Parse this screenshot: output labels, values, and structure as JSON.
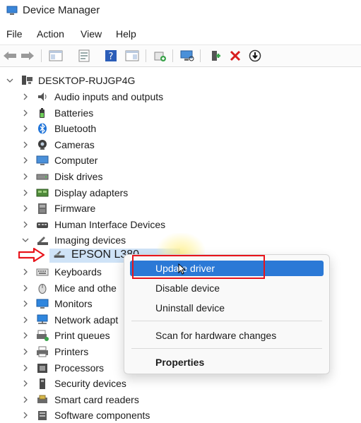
{
  "window": {
    "title": "Device Manager"
  },
  "menubar": {
    "items": [
      "File",
      "Action",
      "View",
      "Help"
    ]
  },
  "toolbar": {
    "icons": [
      "back-arrow-icon",
      "forward-arrow-icon",
      "show-hide-console-tree-icon",
      "properties-icon",
      "help-icon",
      "action-pane-icon",
      "update-driver-icon",
      "scan-hardware-icon",
      "enable-device-icon",
      "uninstall-device-icon",
      "disable-device-icon"
    ]
  },
  "tree": {
    "root": "DESKTOP-RUJGP4G",
    "categories": [
      {
        "label": "Audio inputs and outputs",
        "icon": "speaker-icon"
      },
      {
        "label": "Batteries",
        "icon": "battery-icon"
      },
      {
        "label": "Bluetooth",
        "icon": "bluetooth-icon"
      },
      {
        "label": "Cameras",
        "icon": "camera-icon"
      },
      {
        "label": "Computer",
        "icon": "computer-icon"
      },
      {
        "label": "Disk drives",
        "icon": "disk-drive-icon"
      },
      {
        "label": "Display adapters",
        "icon": "display-adapter-icon"
      },
      {
        "label": "Firmware",
        "icon": "firmware-icon"
      },
      {
        "label": "Human Interface Devices",
        "icon": "hid-icon"
      },
      {
        "label": "Imaging devices",
        "icon": "imaging-device-icon",
        "expanded": true
      },
      {
        "label": "Keyboards",
        "icon": "keyboard-icon"
      },
      {
        "label": "Mice and othe",
        "icon": "mouse-icon"
      },
      {
        "label": "Monitors",
        "icon": "monitor-icon"
      },
      {
        "label": "Network adapt",
        "icon": "network-adapter-icon"
      },
      {
        "label": "Print queues",
        "icon": "print-queue-icon"
      },
      {
        "label": "Printers",
        "icon": "printer-icon"
      },
      {
        "label": "Processors",
        "icon": "processor-icon"
      },
      {
        "label": "Security devices",
        "icon": "security-device-icon"
      },
      {
        "label": "Smart card readers",
        "icon": "smart-card-reader-icon"
      },
      {
        "label": "Software components",
        "icon": "software-component-icon"
      }
    ],
    "selected_child": {
      "label": "EPSON L380",
      "icon": "scanner-icon"
    }
  },
  "context_menu": {
    "items": [
      "Update driver",
      "Disable device",
      "Uninstall device",
      "Scan for hardware changes",
      "Properties"
    ]
  },
  "colors": {
    "highlight": "#2b79d6",
    "annotation_red": "#e8141b",
    "selection": "#cfe3f7"
  }
}
